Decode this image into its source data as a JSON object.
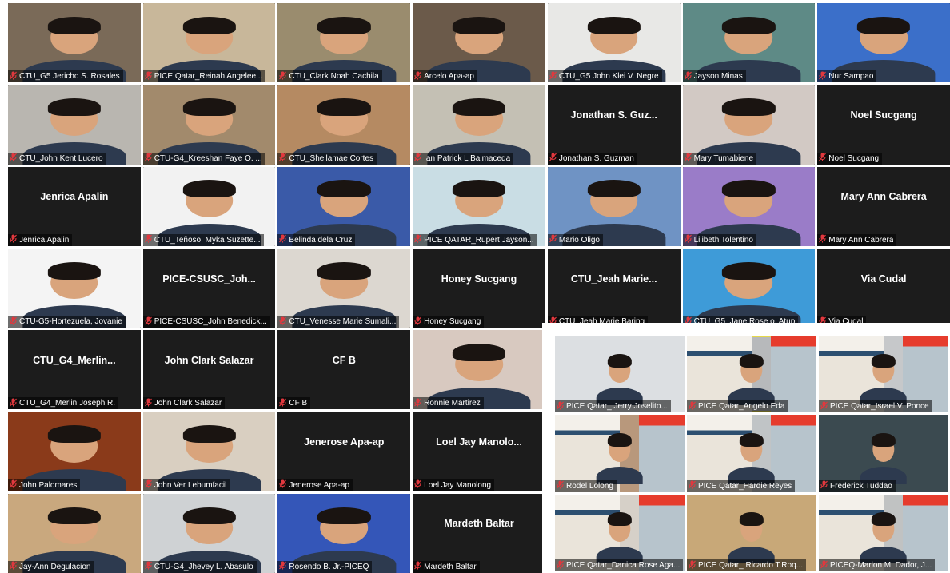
{
  "colors": {
    "tile_bg": "#1c1c1c",
    "muted_icon": "#e0383e",
    "active_speaker": "#e6d94a"
  },
  "participants": [
    {
      "name": "CTU_G5 Jericho S. Rosales",
      "placeholder": "",
      "video": true,
      "tone": "#7a6a58"
    },
    {
      "name": "PICE Qatar_Reinah Angelee...",
      "placeholder": "",
      "video": true,
      "tone": "#c8b79a"
    },
    {
      "name": "CTU_Clark Noah Cachila",
      "placeholder": "",
      "video": true,
      "tone": "#9a8c6e"
    },
    {
      "name": "Arcelo Apa-ap",
      "placeholder": "",
      "video": true,
      "tone": "#6b5a4a"
    },
    {
      "name": "CTU_G5 John Klei V. Negre",
      "placeholder": "",
      "video": true,
      "tone": "#e8e8e6"
    },
    {
      "name": "Jayson Minas",
      "placeholder": "",
      "video": true,
      "tone": "#5e8a86"
    },
    {
      "name": "Nur Sampao",
      "placeholder": "",
      "video": true,
      "tone": "#3b6fc9"
    },
    {
      "name": "CTU_John Kent Lucero",
      "placeholder": "",
      "video": true,
      "tone": "#b9b6b0"
    },
    {
      "name": "CTU-G4_Kreeshan Faye O. ...",
      "placeholder": "",
      "video": true,
      "tone": "#a28a6c"
    },
    {
      "name": "CTU_Shellamae Cortes",
      "placeholder": "",
      "video": true,
      "tone": "#b58a62"
    },
    {
      "name": "Ian Patrick L Balmaceda",
      "placeholder": "",
      "video": true,
      "tone": "#c4c0b4"
    },
    {
      "name": "Jonathan S. Guzman",
      "placeholder": "Jonathan S. Guz...",
      "video": false,
      "tone": ""
    },
    {
      "name": "Mary Tumabiene",
      "placeholder": "",
      "video": true,
      "tone": "#d2c9c4"
    },
    {
      "name": "Noel Sucgang",
      "placeholder": "Noel Sucgang",
      "video": false,
      "tone": ""
    },
    {
      "name": "Jenrica Apalin",
      "placeholder": "Jenrica Apalin",
      "video": false,
      "tone": ""
    },
    {
      "name": "CTU_Teñoso, Myka Suzette...",
      "placeholder": "",
      "video": true,
      "tone": "#f2f2f2"
    },
    {
      "name": "Belinda dela Cruz",
      "placeholder": "",
      "video": true,
      "tone": "#3a5aa8"
    },
    {
      "name": "PICE QATAR_Rupert Jayson...",
      "placeholder": "",
      "video": true,
      "tone": "#c9dde4"
    },
    {
      "name": "Mario Oligo",
      "placeholder": "",
      "video": true,
      "tone": "#6f93c4"
    },
    {
      "name": "Lilibeth Tolentino",
      "placeholder": "",
      "video": true,
      "tone": "#9a7cc8"
    },
    {
      "name": "Mary Ann Cabrera",
      "placeholder": "Mary Ann Cabrera",
      "video": false,
      "tone": ""
    },
    {
      "name": "CTU-G5-Hortezuela, Jovanie",
      "placeholder": "",
      "video": true,
      "tone": "#f4f4f4"
    },
    {
      "name": "PICE-CSUSC_John Benedick...",
      "placeholder": "PICE-CSUSC_Joh...",
      "video": false,
      "tone": ""
    },
    {
      "name": "CTU_Venesse Marie Sumali...",
      "placeholder": "",
      "video": true,
      "tone": "#dcd7d0"
    },
    {
      "name": "Honey Sucgang",
      "placeholder": "Honey Sucgang",
      "video": false,
      "tone": ""
    },
    {
      "name": "CTU_Jeah Marie Baring",
      "placeholder": "CTU_Jeah  Marie...",
      "video": false,
      "tone": ""
    },
    {
      "name": "CTU_G5_Jane Rose o. Atup",
      "placeholder": "",
      "video": true,
      "tone": "#3e9bd8"
    },
    {
      "name": "Via Cudal",
      "placeholder": "Via Cudal",
      "video": false,
      "tone": ""
    },
    {
      "name": "CTU_G4_Merlin Joseph R.",
      "placeholder": "CTU_G4_Merlin...",
      "video": false,
      "tone": ""
    },
    {
      "name": "John Clark Salazar",
      "placeholder": "John Clark Salazar",
      "video": false,
      "tone": ""
    },
    {
      "name": "CF B",
      "placeholder": "CF B",
      "video": false,
      "tone": ""
    },
    {
      "name": "Ronnie Martirez",
      "placeholder": "",
      "video": true,
      "tone": "#d8c9c0"
    },
    {
      "name": "",
      "placeholder": "",
      "video": false,
      "tone": ""
    },
    {
      "name": "",
      "placeholder": "",
      "video": false,
      "tone": ""
    },
    {
      "name": "",
      "placeholder": "",
      "video": false,
      "tone": ""
    },
    {
      "name": "John Palomares",
      "placeholder": "",
      "video": true,
      "tone": "#8a3a1a"
    },
    {
      "name": "John Ver Lebumfacil",
      "placeholder": "",
      "video": true,
      "tone": "#d9cfc1"
    },
    {
      "name": "Jenerose Apa-ap",
      "placeholder": "Jenerose Apa-ap",
      "video": false,
      "tone": ""
    },
    {
      "name": "Loel Jay Manolong",
      "placeholder": "Loel Jay  Manolo...",
      "video": false,
      "tone": ""
    },
    {
      "name": "",
      "placeholder": "",
      "video": false,
      "tone": ""
    },
    {
      "name": "",
      "placeholder": "",
      "video": false,
      "tone": ""
    },
    {
      "name": "",
      "placeholder": "",
      "video": false,
      "tone": ""
    },
    {
      "name": "Jay-Ann Degulacion",
      "placeholder": "",
      "video": true,
      "tone": "#c9a87e"
    },
    {
      "name": "CTU-G4_Jhevey L. Abasulo",
      "placeholder": "",
      "video": true,
      "tone": "#cfd2d4"
    },
    {
      "name": "Rosendo B. Jr.-PICEQ",
      "placeholder": "",
      "video": true,
      "tone": "#3456b8"
    },
    {
      "name": "Mardeth Baltar",
      "placeholder": "Mardeth Baltar",
      "video": false,
      "tone": ""
    },
    {
      "name": "",
      "placeholder": "",
      "video": false,
      "tone": ""
    },
    {
      "name": "",
      "placeholder": "",
      "video": false,
      "tone": ""
    },
    {
      "name": "",
      "placeholder": "",
      "video": false,
      "tone": ""
    }
  ],
  "inset_participants": [
    {
      "name": "PICE Qatar_ Jerry Joselito...",
      "poster": false,
      "tone": "#dcdfe2",
      "active": false
    },
    {
      "name": "PICE Qatar_Angelo Eda",
      "poster": true,
      "tone": "#b7b9bb",
      "active": true
    },
    {
      "name": "PICE Qatar_Israel V. Ponce",
      "poster": true,
      "tone": "#c6c8ca",
      "active": false
    },
    {
      "name": "Rodel Lolong",
      "poster": true,
      "tone": "#b8987c",
      "active": false
    },
    {
      "name": "PICE Qatar_Hardie Reyes",
      "poster": true,
      "tone": "#c0c4c6",
      "active": false
    },
    {
      "name": "Frederick Tuddao",
      "poster": false,
      "tone": "#3b4a50",
      "active": false
    },
    {
      "name": "PICE Qatar_Danica Rose Aga...",
      "poster": true,
      "tone": "#d6d0c8",
      "active": false
    },
    {
      "name": "PICE Qatar_ Ricardo T.Roq...",
      "poster": false,
      "tone": "#c8a878",
      "active": false
    },
    {
      "name": "PICEQ-Marlon M. Dador, J...",
      "poster": true,
      "tone": "#c0c2c2",
      "active": false
    }
  ]
}
